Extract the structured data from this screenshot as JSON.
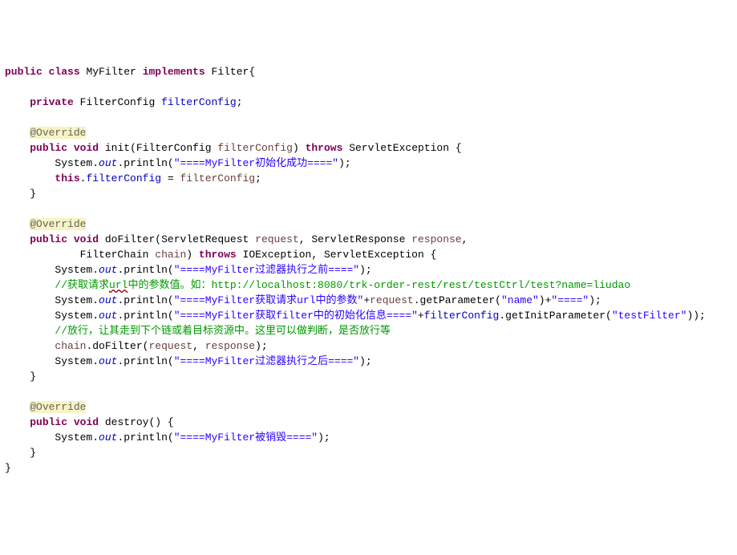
{
  "code": {
    "kw_public": "public",
    "kw_class": "class",
    "class_name": "MyFilter",
    "kw_implements": "implements",
    "iface": "Filter",
    "kw_private": "private",
    "type_FilterConfig": "FilterConfig",
    "field_filterConfig": "filterConfig",
    "ann_override": "@Override",
    "kw_void": "void",
    "m_init": "init",
    "param_filterConfig": "filterConfig",
    "kw_throws": "throws",
    "ex_ServletException": "ServletException",
    "sys": "System",
    "out": "out",
    "println": "println",
    "str_init": "\"====MyFilter初始化成功====\"",
    "kw_this": "this",
    "m_doFilter": "doFilter",
    "type_ServletRequest": "ServletRequest",
    "param_request": "request",
    "type_ServletResponse": "ServletResponse",
    "param_response": "response",
    "type_FilterChain": "FilterChain",
    "param_chain": "chain",
    "ex_IOException": "IOException",
    "str_before": "\"====MyFilter过滤器执行之前====\"",
    "cmt_get_prefix": "//获取请求",
    "cmt_get_url": "url",
    "cmt_get_suffix": "中的参数值。如：http://localhost:8080/trk-order-rest/rest/testCtrl/test?name=liudao",
    "str_getparam": "\"====MyFilter获取请求url中的参数\"",
    "m_getParameter": "getParameter",
    "str_arg_name": "\"name\"",
    "str_tail": "\"====\"",
    "str_getfilterinit": "\"====MyFilter获取filter中的初始化信息====\"",
    "m_getInitParameter": "getInitParameter",
    "str_arg_testFilter": "\"testFilter\"",
    "cmt_release": "//放行，让其走到下个链或着目标资源中。这里可以做判断，是否放行等",
    "chain": "chain",
    "m_doFilter_call": "doFilter",
    "str_after": "\"====MyFilter过滤器执行之后====\"",
    "m_destroy": "destroy",
    "str_destroy": "\"====MyFilter被销毁====\""
  }
}
